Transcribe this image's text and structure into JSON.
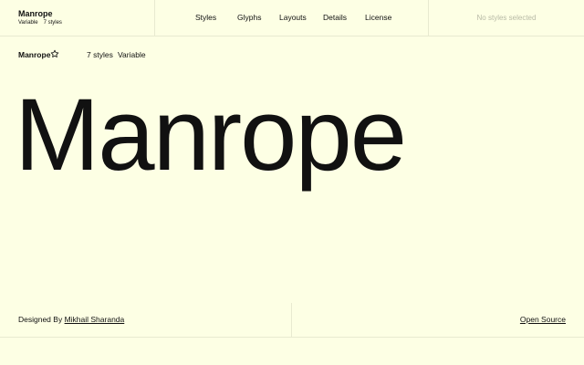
{
  "header": {
    "brand_name": "Manrope",
    "brand_type": "Variable",
    "brand_styles": "7 styles",
    "nav": {
      "styles": "Styles",
      "glyphs": "Glyphs",
      "layouts": "Layouts",
      "details": "Details",
      "license": "License"
    },
    "selection_status": "No styles selected"
  },
  "subbar": {
    "font_name": "Manrope",
    "favorite_icon": "star-outline-icon",
    "styles_count": "7 styles",
    "variable_label": "Variable"
  },
  "specimen": {
    "text": "Manrope"
  },
  "footer": {
    "designed_by_prefix": "Designed By",
    "designer_name": "Mikhail Sharanda",
    "license_link": "Open Source"
  },
  "colors": {
    "background": "#fdffe4",
    "text": "#111111",
    "muted": "#b8baa6",
    "divider": "#e8ead0"
  }
}
